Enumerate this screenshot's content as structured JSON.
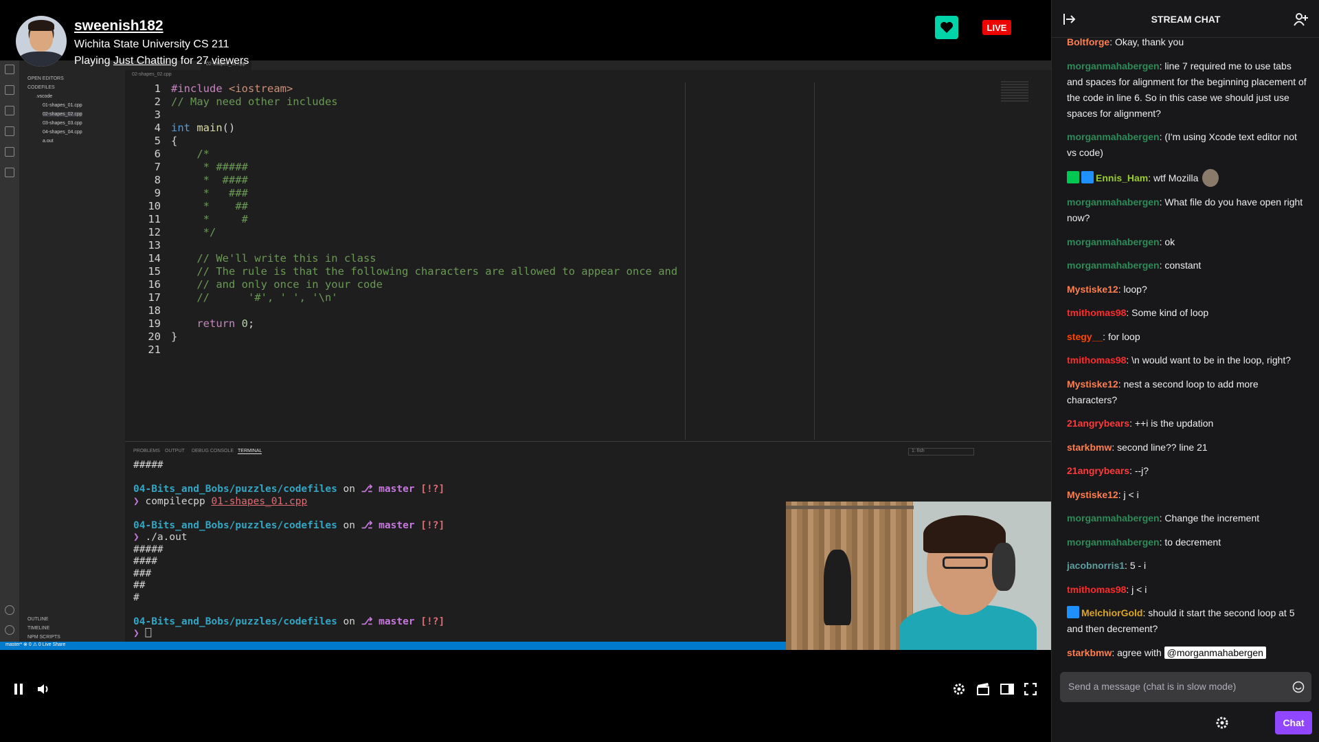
{
  "stream": {
    "streamer": "sweenish182",
    "title": "Wichita State University CS 211",
    "playing_prefix": "Playing ",
    "game": "Just Chatting",
    "viewers_text": " for 27 viewers",
    "live_label": "LIVE"
  },
  "vscode": {
    "sidebar": {
      "open_editors": "OPEN EDITORS",
      "folder": "CODEFILES",
      "subfolder": ".vscode",
      "files": [
        "01-shapes_01.cpp",
        "02-shapes_02.cpp",
        "03-shapes_03.cpp",
        "04-shapes_04.cpp",
        "a.out"
      ],
      "outline": "OUTLINE",
      "timeline": "TIMELINE",
      "npm": "NPM SCRIPTS"
    },
    "tab": "02-shapes_02.cpp",
    "breadcrumb": "02-shapes_02.cpp",
    "code_lines": [
      "#include <iostream>",
      "// May need other includes",
      "",
      "int main()",
      "{",
      "    /*",
      "     * #####",
      "     *  ####",
      "     *   ###",
      "     *    ##",
      "     *     #",
      "     */",
      "",
      "    // We'll write this in class",
      "    // The rule is that the following characters are allowed to appear once and",
      "    // and only once in your code",
      "    //      '#', ' ', '\\n'",
      "",
      "    return 0;",
      "}",
      ""
    ],
    "panel_tabs": [
      "PROBLEMS",
      "OUTPUT",
      "DEBUG CONSOLE",
      "TERMINAL"
    ],
    "terminal_select": "1: fish",
    "terminal": {
      "top": "#####",
      "path": "04-Bits_and_Bobs/puzzles/codefiles",
      "on": " on ",
      "branch": "master",
      "flag": "[!?]",
      "cmd1": "compilecpp",
      "arg1": "01-shapes_01.cpp",
      "cmd2": "./a.out",
      "output": [
        "#####",
        "####",
        "###",
        "##",
        "#"
      ]
    },
    "status": "master*   ⊗ 0 ⚠ 0   Live Share"
  },
  "chat": {
    "title": "STREAM CHAT",
    "messages": [
      {
        "user": "Boltforge",
        "color": "#ff7f50",
        "text": "Okay, thank you"
      },
      {
        "user": "morganmahabergen",
        "color": "#2e8b57",
        "text": "line 7 required me to use tabs and spaces for alignment for the beginning placement of the code in line 6. So in this case we should just use spaces for alignment?"
      },
      {
        "user": "morganmahabergen",
        "color": "#2e8b57",
        "text": "(I'm using Xcode text editor not vs code)"
      },
      {
        "user": "Ennis_Ham",
        "color": "#9acd32",
        "text": "wtf Mozilla",
        "badges": [
          "#00c853",
          "#1e90ff"
        ],
        "emote": true
      },
      {
        "user": "morganmahabergen",
        "color": "#2e8b57",
        "text": "What file do you have open right now?"
      },
      {
        "user": "morganmahabergen",
        "color": "#2e8b57",
        "text": "ok"
      },
      {
        "user": "morganmahabergen",
        "color": "#2e8b57",
        "text": "constant"
      },
      {
        "user": "Mystiske12",
        "color": "#ff7f50",
        "text": "loop?"
      },
      {
        "user": "tmithomas98",
        "color": "#ff2a2a",
        "text": "Some kind of loop"
      },
      {
        "user": "stegy__",
        "color": "#ff4500",
        "text": "for loop"
      },
      {
        "user": "tmithomas98",
        "color": "#ff2a2a",
        "text": "\\n would want to be in the loop, right?"
      },
      {
        "user": "Mystiske12",
        "color": "#ff7f50",
        "text": "nest a second loop to add more characters?"
      },
      {
        "user": "21angrybears",
        "color": "#ff3a3a",
        "text": "++i is the updation"
      },
      {
        "user": "starkbmw",
        "color": "#ff7f50",
        "text": "second line?? line 21"
      },
      {
        "user": "21angrybears",
        "color": "#ff3a3a",
        "text": "--j?"
      },
      {
        "user": "Mystiske12",
        "color": "#ff7f50",
        "text": "j < i"
      },
      {
        "user": "morganmahabergen",
        "color": "#2e8b57",
        "text": "Change the increment"
      },
      {
        "user": "morganmahabergen",
        "color": "#2e8b57",
        "text": "to decrement"
      },
      {
        "user": "jacobnorris1",
        "color": "#5f9ea0",
        "text": "5 - i"
      },
      {
        "user": "tmithomas98",
        "color": "#ff2a2a",
        "text": "j < i"
      },
      {
        "user": "MelchiorGold",
        "color": "#daa520",
        "text": "should it start the second loop at 5 and then decrement?",
        "badges": [
          "#1e90ff"
        ]
      },
      {
        "user": "starkbmw",
        "color": "#ff7f50",
        "text": "agree with ",
        "mention": "@morganmahabergen"
      }
    ],
    "input_placeholder": "Send a message (chat is in slow mode)",
    "chat_button": "Chat"
  },
  "colors": {
    "accent": "#9147ff",
    "live": "#eb0400",
    "follow": "#00d4a8",
    "vscode_status": "#007acc"
  }
}
